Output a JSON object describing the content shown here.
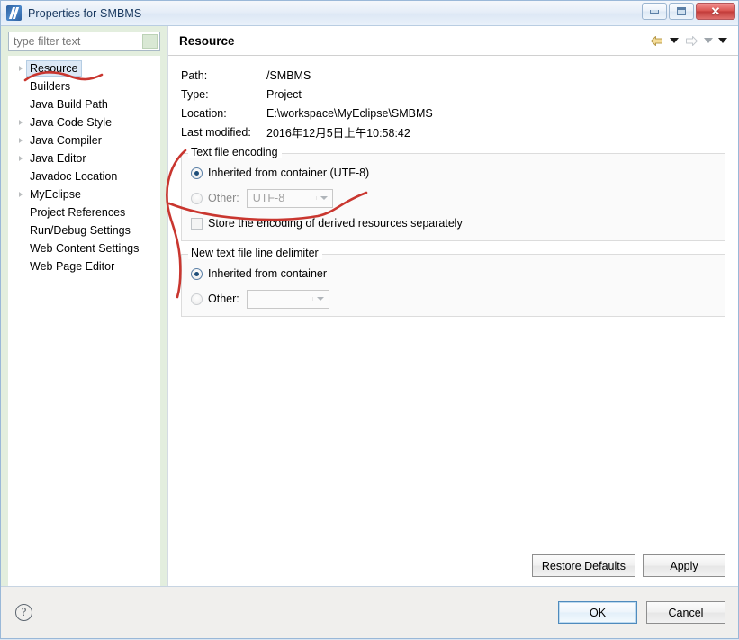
{
  "window": {
    "title": "Properties for SMBMS",
    "app_icon": "eclipse-properties-icon",
    "minimize_label": "Minimize",
    "maximize_label": "Maximize",
    "close_label": "Close"
  },
  "sidebar": {
    "filter": {
      "value": "",
      "placeholder": "type filter text",
      "clear_icon": "clear-filter-icon"
    },
    "items": [
      {
        "label": "Resource",
        "expandable": true,
        "selected": true
      },
      {
        "label": "Builders",
        "expandable": false,
        "selected": false
      },
      {
        "label": "Java Build Path",
        "expandable": false,
        "selected": false
      },
      {
        "label": "Java Code Style",
        "expandable": true,
        "selected": false
      },
      {
        "label": "Java Compiler",
        "expandable": true,
        "selected": false
      },
      {
        "label": "Java Editor",
        "expandable": true,
        "selected": false
      },
      {
        "label": "Javadoc Location",
        "expandable": false,
        "selected": false
      },
      {
        "label": "MyEclipse",
        "expandable": true,
        "selected": false
      },
      {
        "label": "Project References",
        "expandable": false,
        "selected": false
      },
      {
        "label": "Run/Debug Settings",
        "expandable": false,
        "selected": false
      },
      {
        "label": "Web Content Settings",
        "expandable": false,
        "selected": false
      },
      {
        "label": "Web Page Editor",
        "expandable": false,
        "selected": false
      }
    ]
  },
  "page": {
    "title": "Resource",
    "nav": {
      "back_icon": "back-arrow-icon",
      "back_menu_icon": "chevron-down-icon",
      "forward_icon": "forward-arrow-icon",
      "forward_menu_icon": "chevron-down-icon",
      "view_menu_icon": "chevron-down-icon"
    },
    "info": [
      {
        "label": "Path:",
        "value": "/SMBMS"
      },
      {
        "label": "Type:",
        "value": "Project"
      },
      {
        "label": "Location:",
        "value": "E:\\workspace\\MyEclipse\\SMBMS"
      },
      {
        "label": "Last modified:",
        "value": "2016年12月5日上午10:58:42"
      }
    ],
    "encoding_group": {
      "title": "Text file encoding",
      "inherited_label": "Inherited from container (UTF-8)",
      "inherited_selected": true,
      "other_label": "Other:",
      "other_selected": false,
      "other_value": "UTF-8",
      "dropdown_icon": "chevron-down-icon",
      "store_checkbox_label": "Store the encoding of derived resources separately",
      "store_checked": false
    },
    "delimiter_group": {
      "title": "New text file line delimiter",
      "inherited_label": "Inherited from container",
      "inherited_selected": true,
      "other_label": "Other:",
      "other_selected": false,
      "other_value": "",
      "dropdown_icon": "chevron-down-icon"
    },
    "buttons": {
      "restore_defaults": "Restore Defaults",
      "apply": "Apply"
    }
  },
  "footer": {
    "help_icon": "help-question-icon",
    "help_glyph": "?",
    "ok": "OK",
    "cancel": "Cancel"
  },
  "annotation": {
    "ink_color": "#c9362f",
    "strokes": "hand-drawn-red-marks"
  },
  "colors": {
    "titlebar": "#e6eef8",
    "sidebar_bg": "#e3eede",
    "selection": "#dce8f5",
    "radio_dot": "#1f4e79",
    "footer_bg": "#f0efed",
    "ink_red": "#c9362f"
  }
}
